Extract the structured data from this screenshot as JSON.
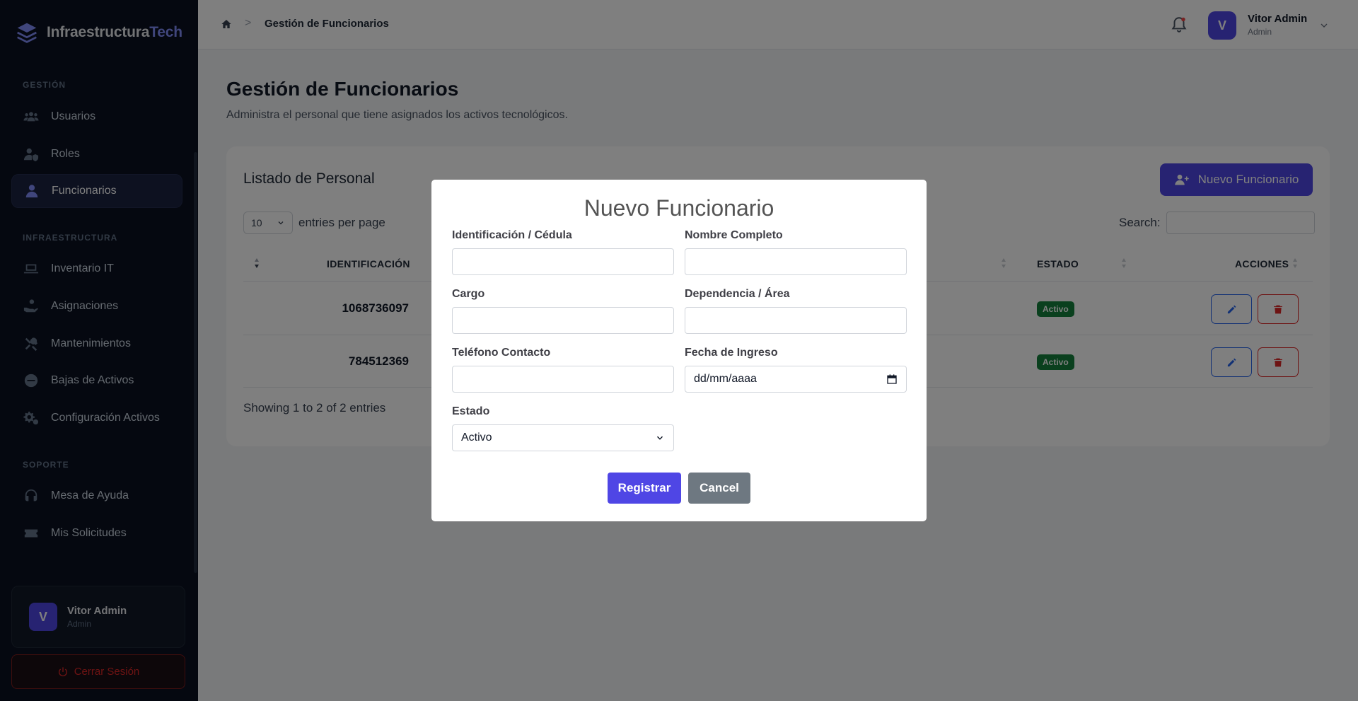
{
  "brand": {
    "name_main": "Infraestructura",
    "name_accent": "Tech"
  },
  "sidebar": {
    "sections": [
      "GESTIÓN",
      "INFRAESTRUCTURA",
      "SOPORTE"
    ],
    "items": [
      {
        "label": "Usuarios",
        "icon": "users-icon"
      },
      {
        "label": "Roles",
        "icon": "user-shield-icon"
      },
      {
        "label": "Funcionarios",
        "icon": "user-icon"
      },
      {
        "label": "Inventario IT",
        "icon": "laptop-icon"
      },
      {
        "label": "Asignaciones",
        "icon": "hand-holding-icon"
      },
      {
        "label": "Mantenimientos",
        "icon": "tools-icon"
      },
      {
        "label": "Bajas de Activos",
        "icon": "minus-circle-icon"
      },
      {
        "label": "Configuración Activos",
        "icon": "cogs-icon"
      },
      {
        "label": "Mesa de Ayuda",
        "icon": "headset-icon"
      },
      {
        "label": "Mis Solicitudes",
        "icon": "ticket-icon"
      }
    ],
    "active_item": "Funcionarios",
    "user": {
      "initial": "V",
      "name": "Vitor Admin",
      "role": "Admin"
    },
    "logout_label": "Cerrar Sesión"
  },
  "topbar": {
    "breadcrumb_current": "Gestión de Funcionarios",
    "breadcrumb_sep": ">",
    "user": {
      "initial": "V",
      "name": "Vitor Admin",
      "role": "Admin"
    }
  },
  "page": {
    "title": "Gestión de Funcionarios",
    "subtitle": "Administra el personal que tiene asignados los activos tecnológicos."
  },
  "card": {
    "title": "Listado de Personal",
    "new_button": "Nuevo Funcionario",
    "entries_value": "10",
    "entries_label": "entries per page",
    "search_label": "Search:",
    "columns": [
      "IDENTIFICACIÓN",
      "ESTADO",
      "ACCIONES"
    ],
    "rows": [
      {
        "id": "1068736097",
        "estado": "Activo"
      },
      {
        "id": "784512369",
        "estado": "Activo"
      }
    ],
    "showing": "Showing 1 to 2 of 2 entries"
  },
  "modal": {
    "title": "Nuevo Funcionario",
    "fields": {
      "identificacion": "Identificación / Cédula",
      "nombre": "Nombre Completo",
      "cargo": "Cargo",
      "dependencia": "Dependencia / Área",
      "telefono": "Teléfono Contacto",
      "fecha": "Fecha de Ingreso",
      "estado": "Estado"
    },
    "fecha_placeholder": "dd/mm/aaaa",
    "estado_value": "Activo",
    "submit_label": "Registrar",
    "cancel_label": "Cancel"
  },
  "colors": {
    "primary": "#4f46e5",
    "sidebar_bg": "#0b1120",
    "success": "#15803d",
    "danger": "#dc2626"
  }
}
